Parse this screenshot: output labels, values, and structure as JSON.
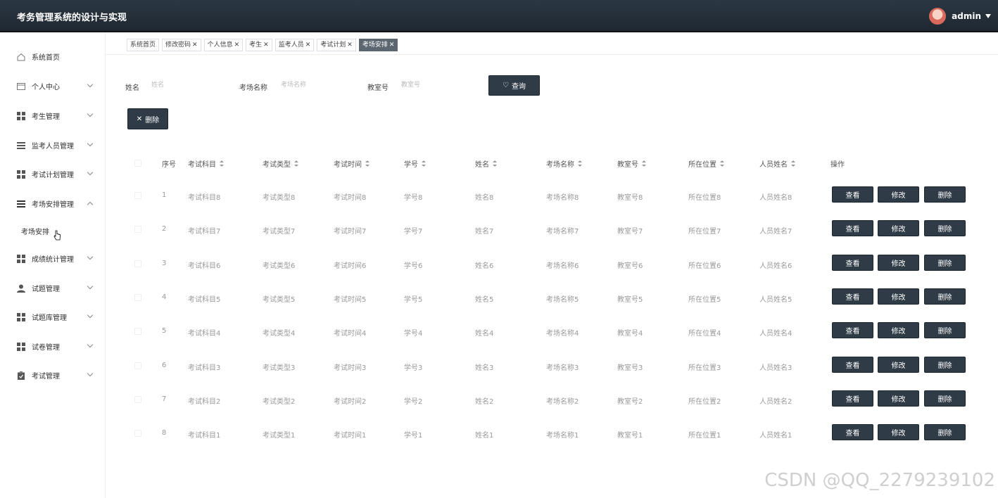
{
  "header": {
    "title": "考务管理系统的设计与实现",
    "user": "admin"
  },
  "sidebar": {
    "items": [
      {
        "label": "系统首页",
        "icon": "home-icon"
      },
      {
        "label": "个人中心",
        "icon": "card-icon"
      },
      {
        "label": "考生管理",
        "icon": "grid-icon"
      },
      {
        "label": "监考人员管理",
        "icon": "list-icon"
      },
      {
        "label": "考试计划管理",
        "icon": "grid-icon"
      },
      {
        "label": "考场安排管理",
        "icon": "menu-icon"
      },
      {
        "label": "成绩统计管理",
        "icon": "grid-icon"
      },
      {
        "label": "试题管理",
        "icon": "user-icon"
      },
      {
        "label": "试题库管理",
        "icon": "grid-icon"
      },
      {
        "label": "试卷管理",
        "icon": "grid-icon"
      },
      {
        "label": "考试管理",
        "icon": "clipboard-icon"
      }
    ],
    "sub_item": "考场安排"
  },
  "tabs": [
    {
      "label": "系统首页",
      "closable": false
    },
    {
      "label": "修改密码",
      "closable": true
    },
    {
      "label": "个人信息",
      "closable": true
    },
    {
      "label": "考生",
      "closable": true
    },
    {
      "label": "监考人员",
      "closable": true
    },
    {
      "label": "考试计划",
      "closable": true
    },
    {
      "label": "考场安排",
      "closable": true,
      "active": true
    }
  ],
  "search": {
    "name_label": "姓名",
    "name_placeholder": "姓名",
    "room_label": "考场名称",
    "room_placeholder": "考场名称",
    "classroom_label": "教室号",
    "classroom_placeholder": "教室号",
    "query_button": "查询"
  },
  "toolbar": {
    "delete_button": "删除"
  },
  "table": {
    "headers": [
      "序号",
      "考试科目",
      "考试类型",
      "考试时间",
      "学号",
      "姓名",
      "考场名称",
      "教室号",
      "所在位置",
      "人员姓名",
      "操作"
    ],
    "actions": [
      "查看",
      "修改",
      "删除"
    ],
    "rows": [
      [
        "1",
        "考试科目8",
        "考试类型8",
        "考试时间8",
        "学号8",
        "姓名8",
        "考场名称8",
        "教室号8",
        "所在位置8",
        "人员姓名8"
      ],
      [
        "2",
        "考试科目7",
        "考试类型7",
        "考试时间7",
        "学号7",
        "姓名7",
        "考场名称7",
        "教室号7",
        "所在位置7",
        "人员姓名7"
      ],
      [
        "3",
        "考试科目6",
        "考试类型6",
        "考试时间6",
        "学号6",
        "姓名6",
        "考场名称6",
        "教室号6",
        "所在位置6",
        "人员姓名6"
      ],
      [
        "4",
        "考试科目5",
        "考试类型5",
        "考试时间5",
        "学号5",
        "姓名5",
        "考场名称5",
        "教室号5",
        "所在位置5",
        "人员姓名5"
      ],
      [
        "5",
        "考试科目4",
        "考试类型4",
        "考试时间4",
        "学号4",
        "姓名4",
        "考场名称4",
        "教室号4",
        "所在位置4",
        "人员姓名4"
      ],
      [
        "6",
        "考试科目3",
        "考试类型3",
        "考试时间3",
        "学号3",
        "姓名3",
        "考场名称3",
        "教室号3",
        "所在位置3",
        "人员姓名3"
      ],
      [
        "7",
        "考试科目2",
        "考试类型2",
        "考试时间2",
        "学号2",
        "姓名2",
        "考场名称2",
        "教室号2",
        "所在位置2",
        "人员姓名2"
      ],
      [
        "8",
        "考试科目1",
        "考试类型1",
        "考试时间1",
        "学号1",
        "姓名1",
        "考场名称1",
        "教室号1",
        "所在位置1",
        "人员姓名1"
      ]
    ]
  },
  "watermark": "CSDN @QQ_2279239102"
}
